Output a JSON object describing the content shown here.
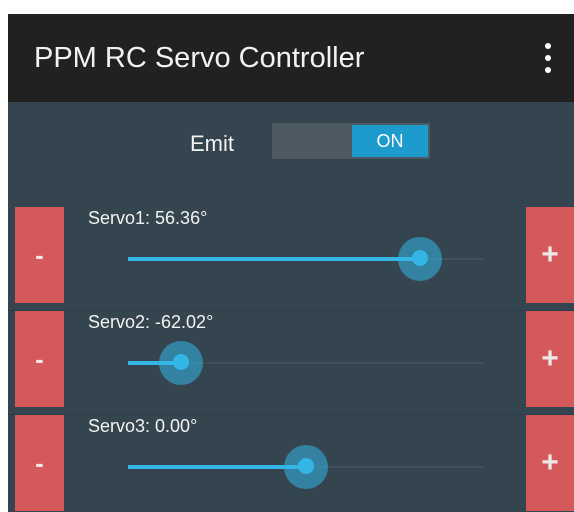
{
  "app": {
    "title": "PPM RC Servo Controller",
    "menu_icon": "overflow-menu-icon"
  },
  "emit": {
    "label": "Emit",
    "toggle_state": "ON",
    "accent": "#1d9bcd"
  },
  "servos": [
    {
      "label": "Servo1: 56.36°",
      "level": 0.82,
      "minus": "-",
      "plus": "+"
    },
    {
      "label": "Servo2: -62.02°",
      "level": 0.15,
      "minus": "-",
      "plus": "+"
    },
    {
      "label": "Servo3: 0.00°",
      "level": 0.5,
      "minus": "-",
      "plus": "+"
    }
  ],
  "colors": {
    "appbar": "#212121",
    "background": "#34454f",
    "button": "#d3595a",
    "slider": "#33b5e5"
  }
}
